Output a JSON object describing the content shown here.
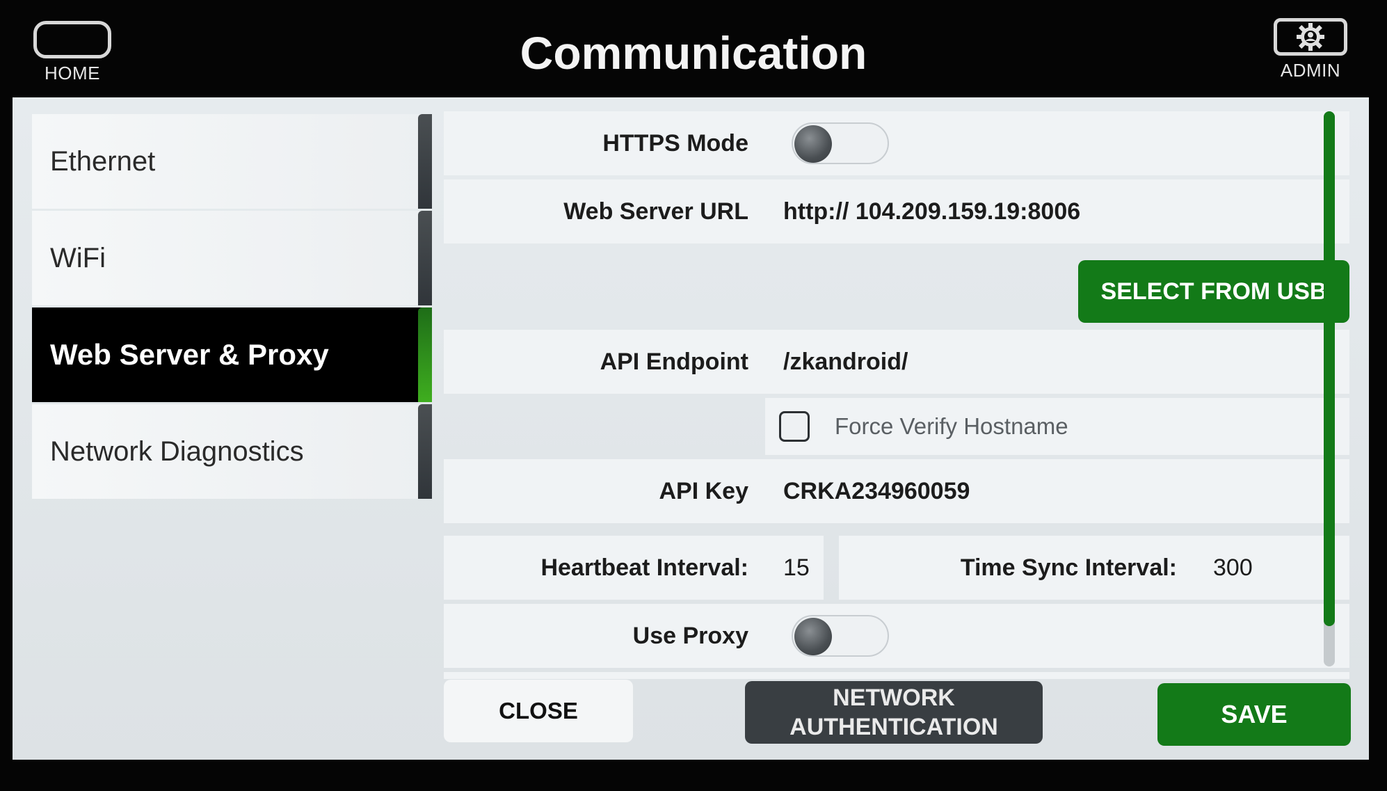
{
  "header": {
    "home_label": "HOME",
    "title": "Communication",
    "admin_label": "ADMIN"
  },
  "nav": {
    "items": [
      {
        "label": "Ethernet",
        "active": false
      },
      {
        "label": "WiFi",
        "active": false
      },
      {
        "label": "Web Server & Proxy",
        "active": true
      },
      {
        "label": "Network Diagnostics",
        "active": false
      }
    ]
  },
  "form": {
    "https_mode": {
      "label": "HTTPS Mode",
      "on": false
    },
    "web_server_url": {
      "label": "Web Server URL",
      "value": "http:// 104.209.159.19:8006"
    },
    "select_usb_label": "SELECT FROM USB",
    "api_endpoint": {
      "label": "API Endpoint",
      "value": "/zkandroid/"
    },
    "force_verify": {
      "label": "Force Verify Hostname",
      "checked": false
    },
    "api_key": {
      "label": "API Key",
      "value": "CRKA234960059"
    },
    "heartbeat": {
      "label": "Heartbeat Interval:",
      "value": "15"
    },
    "time_sync": {
      "label": "Time Sync Interval:",
      "value": "300"
    },
    "use_proxy": {
      "label": "Use Proxy",
      "on": false
    }
  },
  "scroll": {
    "position_fraction": 0.93
  },
  "footer": {
    "close_label": "CLOSE",
    "network_auth_line1": "NETWORK",
    "network_auth_line2": "AUTHENTICATION",
    "save_label": "SAVE"
  },
  "colors": {
    "accent_green": "#137a18",
    "active_nav_bg": "#000000",
    "dark_button": "#393e42"
  }
}
